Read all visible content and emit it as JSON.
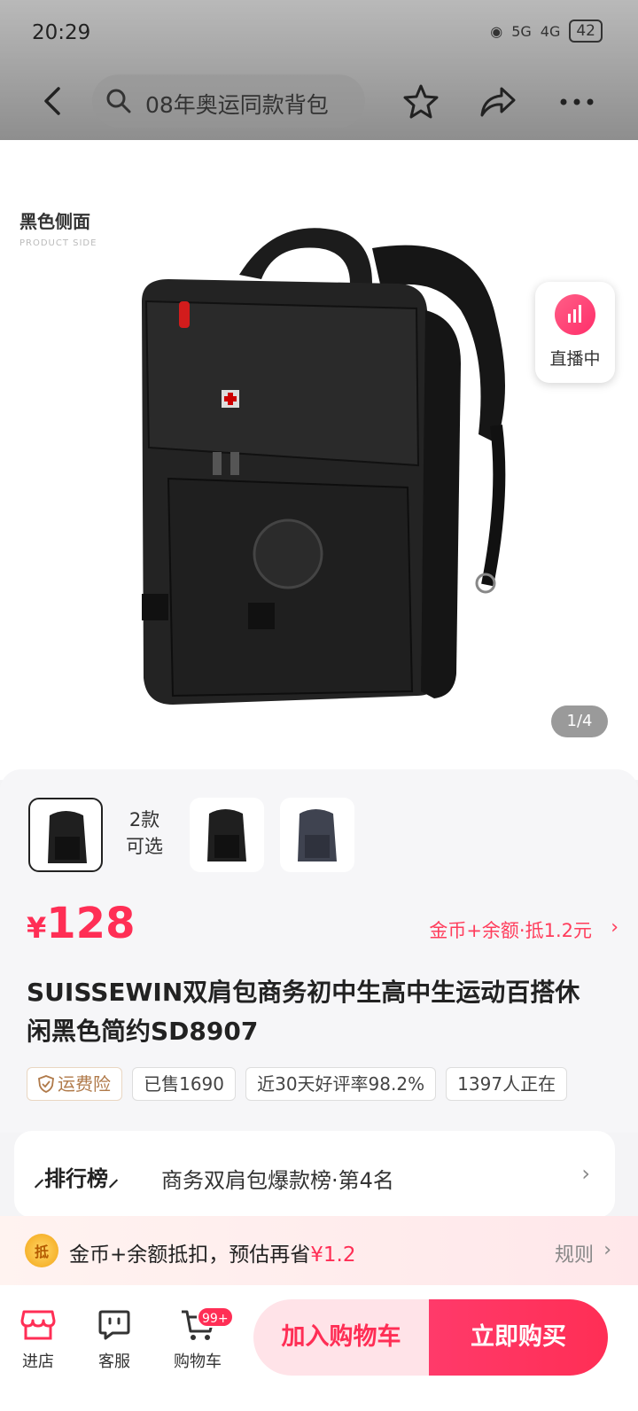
{
  "status_bar": {
    "time": "20:29",
    "battery": "42",
    "net1": "5G",
    "net2": "4G"
  },
  "header": {
    "search_text": "08年奥运同款背包"
  },
  "gallery": {
    "side_label": "黑色侧面",
    "side_label_en": "PRODUCT SIDE",
    "pager": "1/4",
    "live_label": "直播中"
  },
  "variants": {
    "count_line1": "2款",
    "count_line2": "可选"
  },
  "price": {
    "currency": "¥",
    "amount": "128",
    "coin_deduct": "金币+余额·抵1.2元"
  },
  "product": {
    "title": " SUISSEWIN双肩包商务初中生高中生运动百搭休闲黑色简约SD8907"
  },
  "tags": [
    "运费险",
    "已售1690",
    "近30天好评率98.2%",
    "1397人正在"
  ],
  "ranking": {
    "badge": "排行榜",
    "text": "商务双肩包爆款榜·第4名"
  },
  "coins_bar": {
    "icon_text": "抵",
    "text": "金币+余额抵扣，预估再省",
    "save": "¥1.2",
    "rules": "规则"
  },
  "bottom_nav": {
    "store": "进店",
    "service": "客服",
    "cart": "购物车",
    "cart_badge": "99+"
  },
  "actions": {
    "add_to_cart": "加入购物车",
    "buy_now": "立即购买"
  },
  "colors": {
    "accent": "#ff2e55",
    "light_accent": "#ffe3e8"
  }
}
